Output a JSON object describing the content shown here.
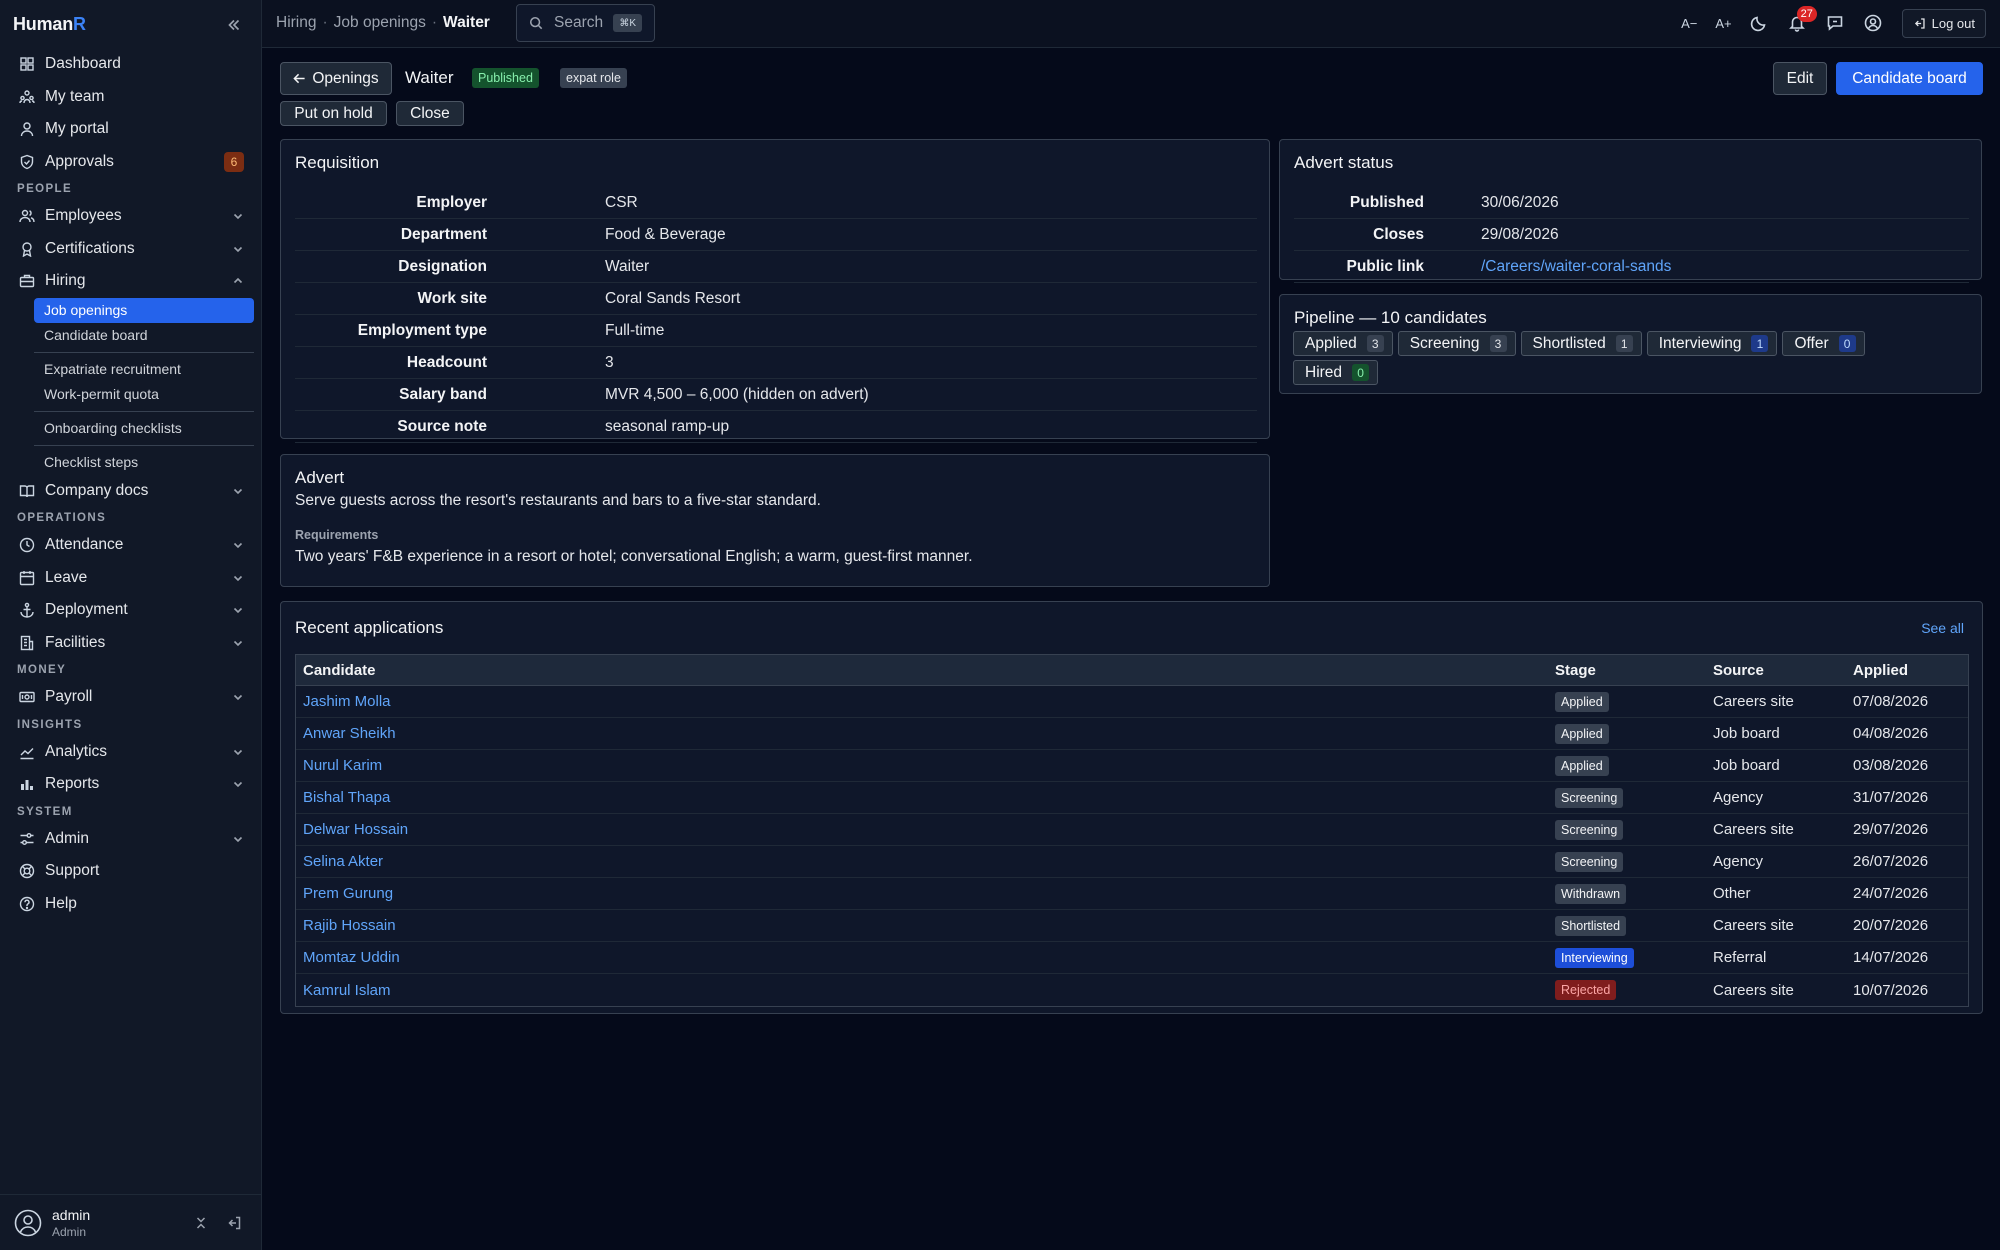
{
  "app": {
    "logo_main": "Human",
    "logo_accent": "R"
  },
  "sidebar": {
    "items": [
      {
        "label": "Dashboard",
        "icon": "dashboard-icon"
      },
      {
        "label": "My team",
        "icon": "team-icon"
      },
      {
        "label": "My portal",
        "icon": "user-icon"
      },
      {
        "label": "Approvals",
        "icon": "shield-icon",
        "count": "6"
      }
    ],
    "sections": {
      "people": "PEOPLE",
      "operations": "OPERATIONS",
      "money": "MONEY",
      "insights": "INSIGHTS",
      "system": "SYSTEM"
    },
    "people": [
      {
        "label": "Employees"
      },
      {
        "label": "Certifications"
      },
      {
        "label": "Hiring"
      }
    ],
    "hiring_sub": [
      "Job openings",
      "Candidate board",
      "Expatriate recruitment",
      "Work-permit quota",
      "Onboarding checklists",
      "Checklist steps"
    ],
    "company_docs": "Company docs",
    "operations": [
      "Attendance",
      "Leave",
      "Deployment",
      "Facilities"
    ],
    "money": [
      "Payroll"
    ],
    "insights": [
      "Analytics",
      "Reports"
    ],
    "system": [
      "Admin",
      "Support",
      "Help"
    ]
  },
  "user": {
    "name": "admin",
    "role": "Admin"
  },
  "topbar": {
    "breadcrumb": [
      "Hiring",
      "Job openings",
      "Waiter"
    ],
    "search_label": "Search",
    "search_kbd": "⌘K",
    "font_smaller": "A−",
    "font_larger": "A+",
    "notifications": "27",
    "logout": "Log out"
  },
  "header": {
    "back": "Openings",
    "title": "Waiter",
    "status": "Published",
    "tag": "expat role",
    "put_on_hold": "Put on hold",
    "close": "Close",
    "edit": "Edit",
    "candidate_board": "Candidate board"
  },
  "requisition": {
    "title": "Requisition",
    "rows": [
      {
        "k": "Employer",
        "v": "CSR"
      },
      {
        "k": "Department",
        "v": "Food & Beverage"
      },
      {
        "k": "Designation",
        "v": "Waiter"
      },
      {
        "k": "Work site",
        "v": "Coral Sands Resort"
      },
      {
        "k": "Employment type",
        "v": "Full-time"
      },
      {
        "k": "Headcount",
        "v": "3"
      },
      {
        "k": "Salary band",
        "v": "MVR 4,500 – 6,000 (hidden on advert)"
      },
      {
        "k": "Source note",
        "v": "seasonal ramp-up"
      }
    ]
  },
  "advert_status": {
    "title": "Advert status",
    "rows": [
      {
        "k": "Published",
        "v": "30/06/2026"
      },
      {
        "k": "Closes",
        "v": "29/08/2026"
      },
      {
        "k": "Public link",
        "v": "/Careers/waiter-coral-sands"
      }
    ]
  },
  "pipeline": {
    "title": "Pipeline — 10 candidates",
    "stages": [
      {
        "label": "Applied",
        "count": "3"
      },
      {
        "label": "Screening",
        "count": "3"
      },
      {
        "label": "Shortlisted",
        "count": "1"
      },
      {
        "label": "Interviewing",
        "count": "1"
      },
      {
        "label": "Offer",
        "count": "0"
      },
      {
        "label": "Hired",
        "count": "0"
      }
    ]
  },
  "advert": {
    "title": "Advert",
    "text": "Serve guests across the resort's restaurants and bars to a five-star standard.",
    "req_label": "Requirements",
    "req_text": "Two years' F&B experience in a resort or hotel; conversational English; a warm, guest-first manner."
  },
  "applications": {
    "title": "Recent applications",
    "see_all": "See all",
    "columns": [
      "Candidate",
      "Stage",
      "Source",
      "Applied"
    ],
    "rows": [
      {
        "name": "Jashim Molla",
        "stage": "Applied",
        "source": "Careers site",
        "date": "07/08/2026"
      },
      {
        "name": "Anwar Sheikh",
        "stage": "Applied",
        "source": "Job board",
        "date": "04/08/2026"
      },
      {
        "name": "Nurul Karim",
        "stage": "Applied",
        "source": "Job board",
        "date": "03/08/2026"
      },
      {
        "name": "Bishal Thapa",
        "stage": "Screening",
        "source": "Agency",
        "date": "31/07/2026"
      },
      {
        "name": "Delwar Hossain",
        "stage": "Screening",
        "source": "Careers site",
        "date": "29/07/2026"
      },
      {
        "name": "Selina Akter",
        "stage": "Screening",
        "source": "Agency",
        "date": "26/07/2026"
      },
      {
        "name": "Prem Gurung",
        "stage": "Withdrawn",
        "source": "Other",
        "date": "24/07/2026"
      },
      {
        "name": "Rajib Hossain",
        "stage": "Shortlisted",
        "source": "Careers site",
        "date": "20/07/2026"
      },
      {
        "name": "Momtaz Uddin",
        "stage": "Interviewing",
        "source": "Referral",
        "date": "14/07/2026"
      },
      {
        "name": "Kamrul Islam",
        "stage": "Rejected",
        "source": "Careers site",
        "date": "10/07/2026"
      }
    ]
  }
}
